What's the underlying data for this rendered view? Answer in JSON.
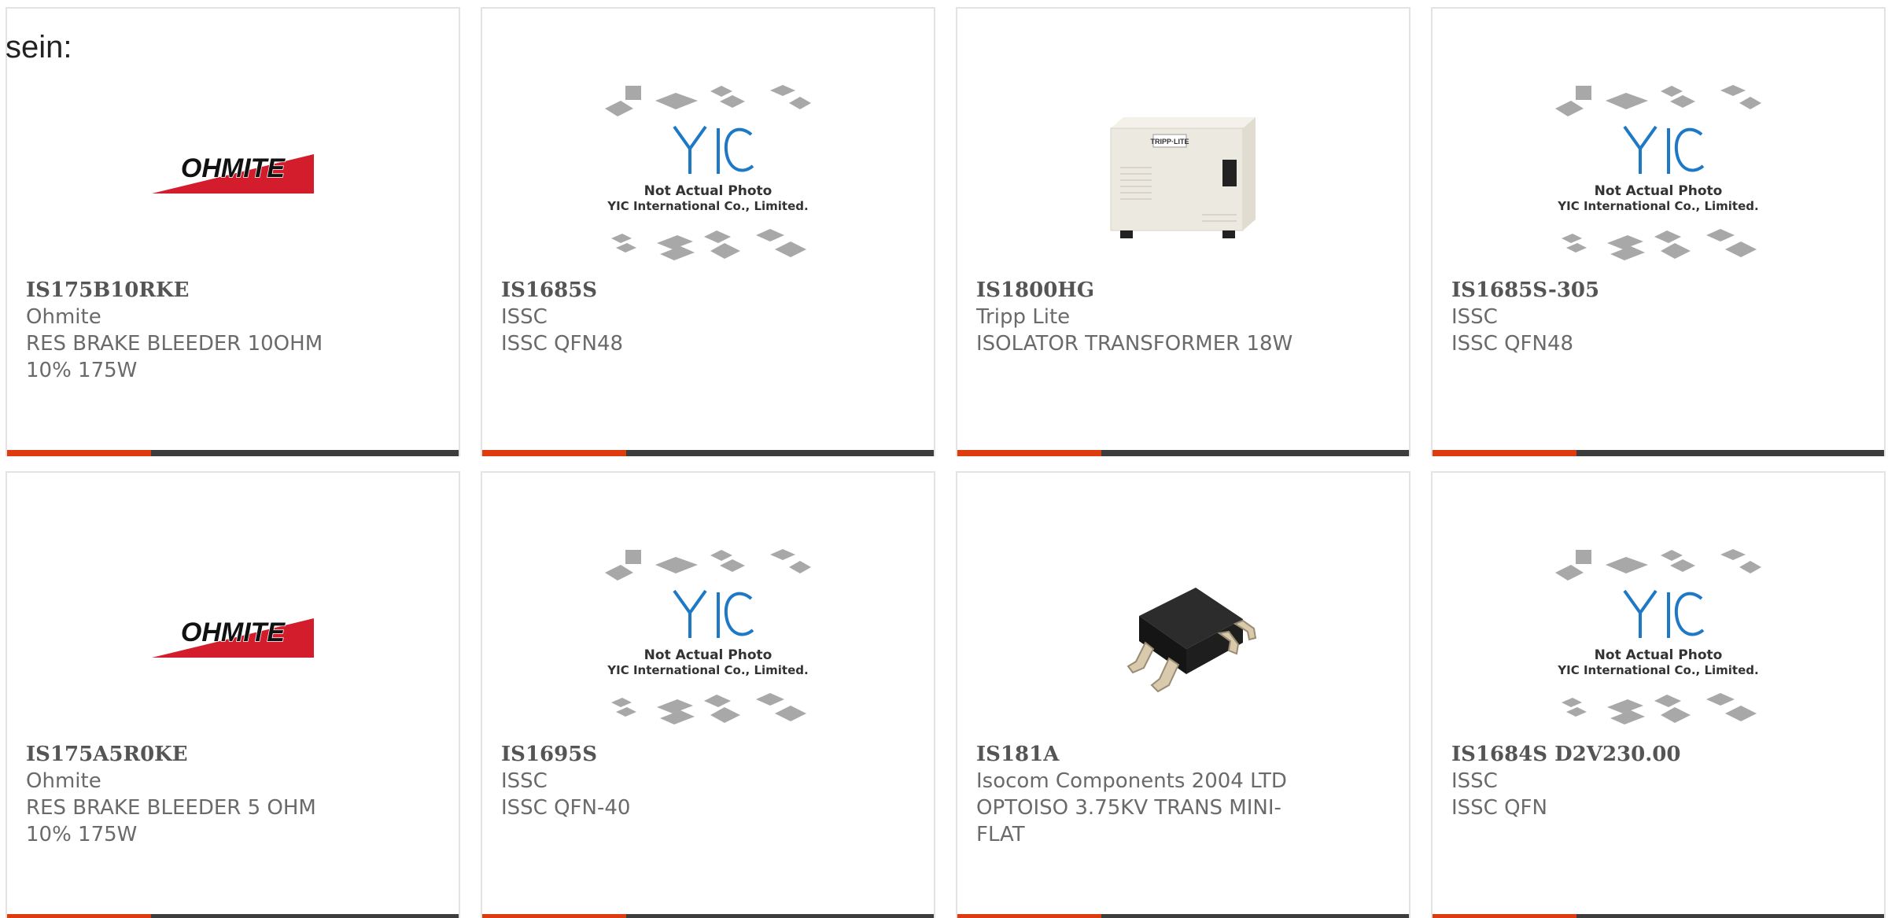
{
  "prefix_text": "sein:",
  "colors": {
    "accent": "#dd3b10",
    "bar_dark": "#3d3d3d",
    "ohmite_red": "#d41d2c",
    "yic_blue": "#1d78c6"
  },
  "products": [
    {
      "part_number": "IS175B10RKE",
      "manufacturer": "Ohmite",
      "description": "RES BRAKE BLEEDER 10OHM 10% 175W",
      "image": "ohmite-logo"
    },
    {
      "part_number": "IS1685S",
      "manufacturer": "ISSC",
      "description": "ISSC QFN48",
      "image": "yic-placeholder"
    },
    {
      "part_number": "IS1800HG",
      "manufacturer": "Tripp Lite",
      "description": "ISOLATOR TRANSFORMER 18W",
      "image": "tripp-lite-transformer"
    },
    {
      "part_number": "IS1685S-305",
      "manufacturer": "ISSC",
      "description": "ISSC QFN48",
      "image": "yic-placeholder"
    },
    {
      "part_number": "IS175A5R0KE",
      "manufacturer": "Ohmite",
      "description": "RES BRAKE BLEEDER 5 OHM 10% 175W",
      "image": "ohmite-logo"
    },
    {
      "part_number": "IS1695S",
      "manufacturer": "ISSC",
      "description": "ISSC QFN-40",
      "image": "yic-placeholder"
    },
    {
      "part_number": "IS181A",
      "manufacturer": "Isocom Components 2004 LTD",
      "description": "OPTOISO 3.75KV TRANS MINI-FLAT",
      "image": "optoisolator-chip"
    },
    {
      "part_number": "IS1684S D2V230.00",
      "manufacturer": "ISSC",
      "description": "ISSC QFN",
      "image": "yic-placeholder"
    }
  ],
  "logos": {
    "ohmite": "OHMITE",
    "tripp_lite": "TRIPP·LITE"
  },
  "yic_placeholder": {
    "brand": "YIC",
    "line1": "Not Actual Photo",
    "line2": "YIC International Co., Limited."
  }
}
